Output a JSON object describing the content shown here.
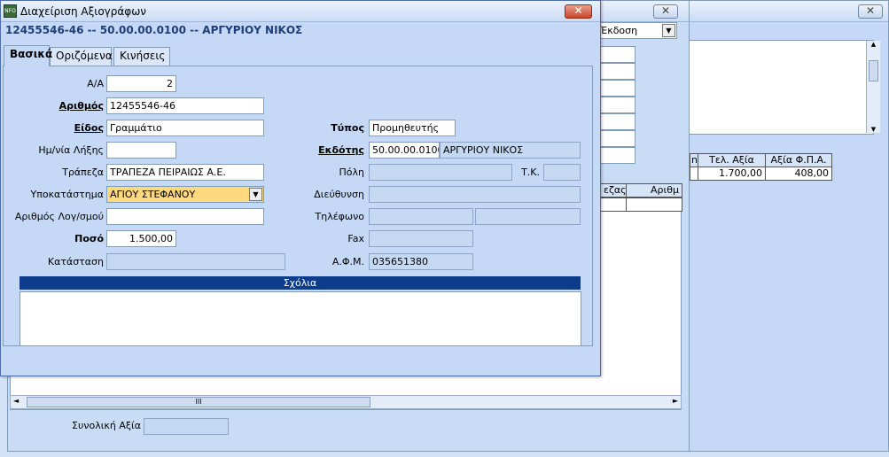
{
  "dialog": {
    "title": "Διαχείριση Αξιογράφων",
    "icon_text": "NFO",
    "header": "12455546-46 -- 50.00.00.0100 -- ΑΡΓΥΡΙΟΥ ΝΙΚΟΣ",
    "tabs": [
      "Βασικά",
      "Οριζόμενα",
      "Κινήσεις"
    ],
    "close_glyph": "✕"
  },
  "form": {
    "aa_label": "Α/Α",
    "aa_value": "2",
    "number_label": "Αριθμός",
    "number_value": "12455546-46",
    "kind_label": "Είδος",
    "kind_value": "Γραμμάτιο",
    "due_label": "Ημ/νία Λήξης",
    "due_value": "",
    "bank_label": "Τράπεζα",
    "bank_value": "ΤΡΑΠΕΖΑ ΠΕΙΡΑΙΩΣ Α.Ε.",
    "branch_label": "Υποκατάστημα",
    "branch_value": "ΑΓΙΟΥ ΣΤΕΦΑΝΟΥ",
    "account_label": "Αριθμός Λογ/σμού",
    "account_value": "",
    "amount_label": "Ποσό",
    "amount_value": "1.500,00",
    "status_label": "Κατάσταση",
    "status_value": "",
    "type_label": "Τύπος",
    "type_value": "Προμηθευτής",
    "issuer_label": "Εκδότης",
    "issuer_code": "50.00.00.0100",
    "issuer_name": "ΑΡΓΥΡΙΟΥ ΝΙΚΟΣ",
    "city_label": "Πόλη",
    "city_value": "",
    "zip_label": "Τ.Κ.",
    "zip_value": "",
    "address_label": "Διεύθυνση",
    "address_value": "",
    "phone_label": "Τηλέφωνο",
    "phone_value": "",
    "phone2_value": "",
    "fax_label": "Fax",
    "fax_value": "",
    "afm_label": "Α.Φ.Μ.",
    "afm_value": "035651380",
    "comments_label": "Σχόλια",
    "comments_value": ""
  },
  "background": {
    "mid_close": "✕",
    "right_close": "✕",
    "select_value": "Έκδοση",
    "grid_headers": [
      "n",
      "Τελ. Αξία",
      "Αξία Φ.Π.Α."
    ],
    "grid_row": [
      "",
      "1.700,00",
      "408,00"
    ],
    "grid2_headers": [
      "εζας",
      "Αριθμ"
    ],
    "total_label": "Συνολική Αξία",
    "total_value": "",
    "scroll_grip": "III"
  },
  "colors": {
    "section_bar": "#0c3c8a",
    "highlight_field": "#ffd880",
    "header_text": "#1f3e7a"
  }
}
